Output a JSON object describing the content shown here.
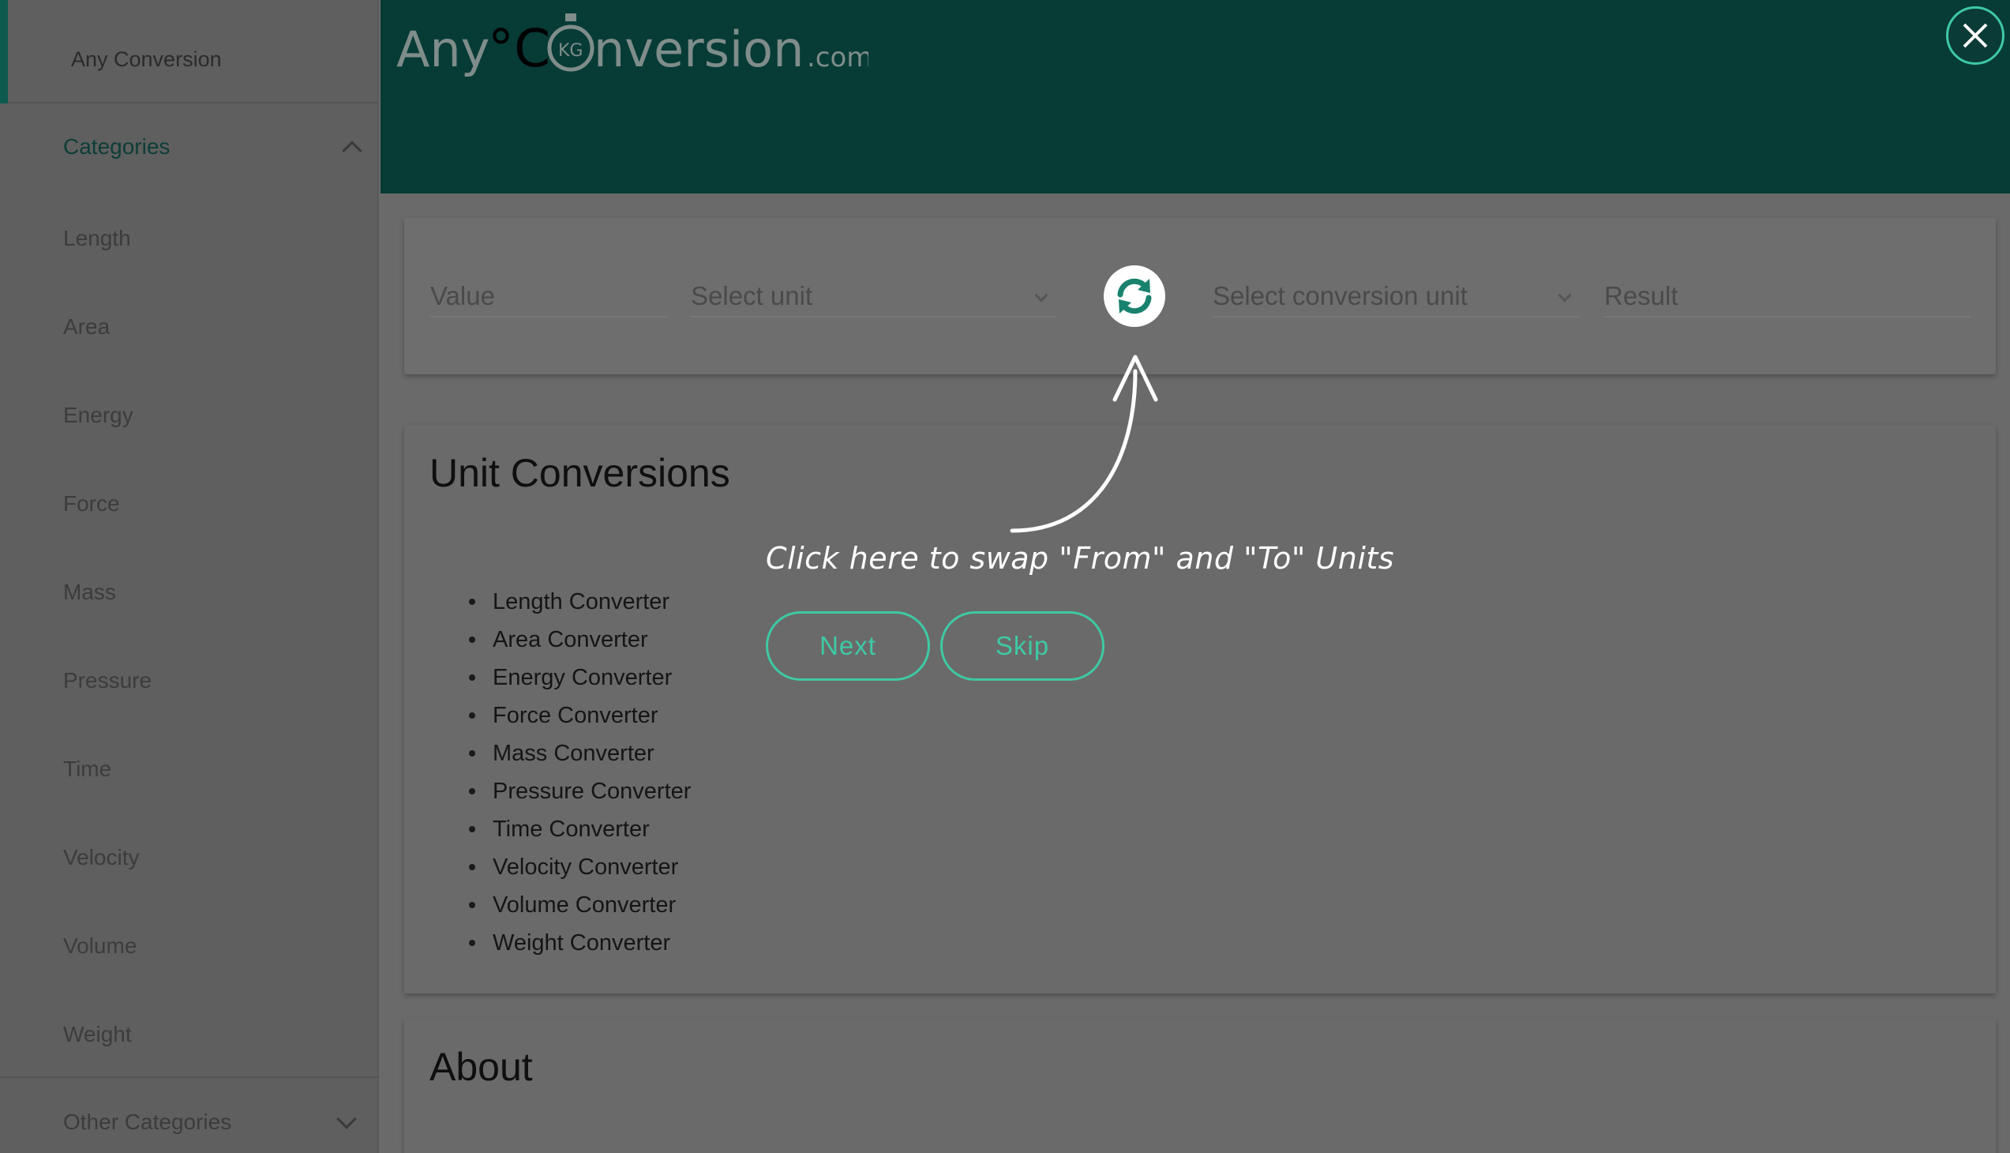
{
  "sidebar": {
    "app_label": "Any Conversion",
    "categories_label": "Categories",
    "items": [
      {
        "label": "Length"
      },
      {
        "label": "Area"
      },
      {
        "label": "Energy"
      },
      {
        "label": "Force"
      },
      {
        "label": "Mass"
      },
      {
        "label": "Pressure"
      },
      {
        "label": "Time"
      },
      {
        "label": "Velocity"
      },
      {
        "label": "Volume"
      },
      {
        "label": "Weight"
      }
    ],
    "other_label": "Other Categories"
  },
  "header": {
    "logo": {
      "left": "Any",
      "degree": "°C",
      "badge": "KG",
      "right": "nversion",
      "tld": ".com"
    }
  },
  "converter": {
    "value_placeholder": "Value",
    "from_unit_placeholder": "Select unit",
    "to_unit_placeholder": "Select conversion unit",
    "result_placeholder": "Result"
  },
  "unit_conversions": {
    "title": "Unit Conversions",
    "items": [
      "Length Converter",
      "Area Converter",
      "Energy Converter",
      "Force Converter",
      "Mass Converter",
      "Pressure Converter",
      "Time Converter",
      "Velocity Converter",
      "Volume Converter",
      "Weight Converter"
    ]
  },
  "about": {
    "title": "About"
  },
  "tour": {
    "hint": "Click here to swap \"From\" and \"To\" Units",
    "next_label": "Next",
    "skip_label": "Skip"
  },
  "colors": {
    "header_bg": "#073b36",
    "accent": "#3ec9a4",
    "overlay": "#6a6a6a"
  }
}
